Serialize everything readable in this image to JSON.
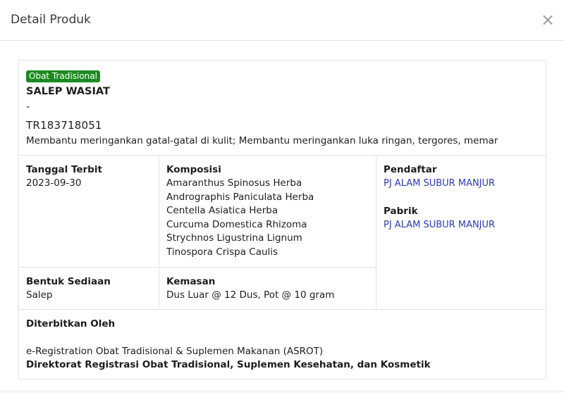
{
  "modal": {
    "title": "Detail Produk",
    "close_glyph": "×"
  },
  "product": {
    "badge": "Obat Tradisional",
    "name": "SALEP WASIAT",
    "dash": "-",
    "registration_number": "TR183718051",
    "description": "Membantu meringankan gatal-gatal di kulit; Membantu meringankan luka ringan, tergores, memar"
  },
  "details": {
    "tanggal_terbit": {
      "label": "Tanggal Terbit",
      "value": "2023-09-30"
    },
    "komposisi": {
      "label": "Komposisi",
      "items": [
        "Amaranthus Spinosus Herba",
        "Andrographis Paniculata Herba",
        "Centella Asiatica Herba",
        "Curcuma Domestica Rhizoma",
        "Strychnos Ligustrina Lignum",
        "Tinospora Crispa Caulis"
      ]
    },
    "bentuk_sediaan": {
      "label": "Bentuk Sediaan",
      "value": "Salep"
    },
    "kemasan": {
      "label": "Kemasan",
      "value": "Dus Luar @ 12 Dus, Pot @ 10 gram"
    },
    "pendaftar": {
      "label": "Pendaftar",
      "value": "PJ ALAM SUBUR MANJUR"
    },
    "pabrik": {
      "label": "Pabrik",
      "value": "PJ ALAM SUBUR MANJUR"
    }
  },
  "publisher": {
    "label": "Diterbitkan Oleh",
    "system": "e-Registration Obat Tradisional & Suplemen Makanan (ASROT)",
    "organization": "Direktorat Registrasi Obat Tradisional, Suplemen Kesehatan, dan Kosmetik"
  },
  "colors": {
    "badge_bg": "#1b8a1f",
    "link": "#2a3bb8",
    "border": "#e3e3e3"
  }
}
